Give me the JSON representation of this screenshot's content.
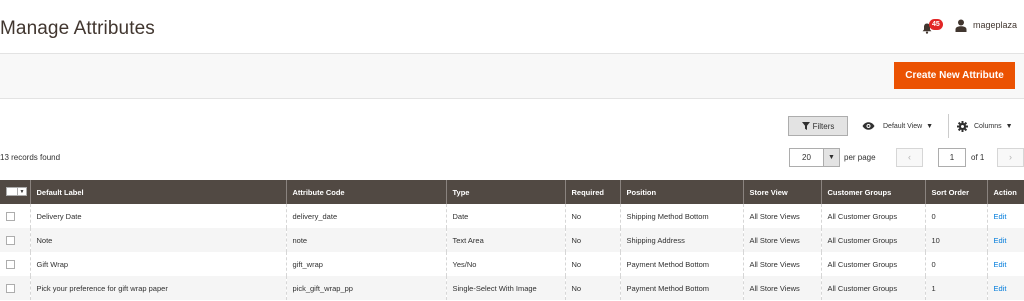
{
  "header": {
    "title": "Manage Attributes",
    "notifications_count": "45",
    "user_name": "mageplaza"
  },
  "actions": {
    "create_label": "Create New Attribute"
  },
  "toolbar": {
    "filters_label": "Filters",
    "view_label": "Default View",
    "columns_label": "Columns",
    "records_found": "13 records found",
    "per_page_value": "20",
    "per_page_label": "per page",
    "page_value": "1",
    "page_of": "of 1"
  },
  "grid": {
    "columns": [
      "Default Label",
      "Attribute Code",
      "Type",
      "Required",
      "Position",
      "Store View",
      "Customer Groups",
      "Sort Order",
      "Action"
    ],
    "rows": [
      {
        "label": "Delivery Date",
        "code": "delivery_date",
        "type": "Date",
        "required": "No",
        "position": "Shipping Method Bottom",
        "store_view": "All Store Views",
        "groups": "All Customer Groups",
        "sort": "0",
        "action": "Edit"
      },
      {
        "label": "Note",
        "code": "note",
        "type": "Text Area",
        "required": "No",
        "position": "Shipping Address",
        "store_view": "All Store Views",
        "groups": "All Customer Groups",
        "sort": "10",
        "action": "Edit"
      },
      {
        "label": "Gift Wrap",
        "code": "gift_wrap",
        "type": "Yes/No",
        "required": "No",
        "position": "Payment Method Bottom",
        "store_view": "All Store Views",
        "groups": "All Customer Groups",
        "sort": "0",
        "action": "Edit"
      },
      {
        "label": "Pick your preference for gift wrap paper",
        "code": "pick_gift_wrap_pp",
        "type": "Single-Select With Image",
        "required": "No",
        "position": "Payment Method Bottom",
        "store_view": "All Store Views",
        "groups": "All Customer Groups",
        "sort": "1",
        "action": "Edit"
      }
    ]
  },
  "colors": {
    "accent": "#eb5202",
    "header_bg": "#514943",
    "link": "#007bdb",
    "badge": "#e22626"
  }
}
